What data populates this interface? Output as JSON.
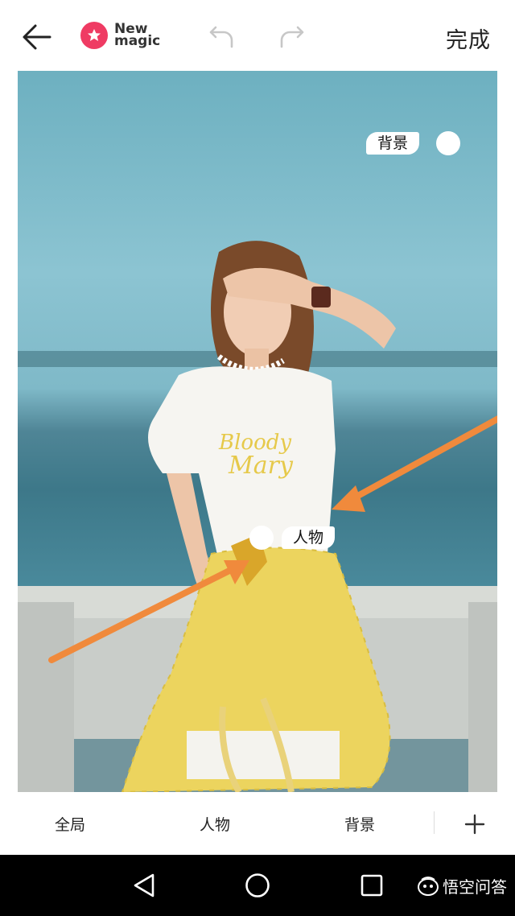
{
  "header": {
    "logo_line1": "New",
    "logo_line2": "magic",
    "done_label": "完成"
  },
  "photo": {
    "shirt_text_line1": "Bloody",
    "shirt_text_line2": "Mary",
    "tag_background": "背景",
    "tag_person": "人物"
  },
  "tabs": [
    {
      "label": "全局"
    },
    {
      "label": "人物"
    },
    {
      "label": "背景"
    }
  ],
  "watermark": {
    "text": "悟空问答"
  },
  "colors": {
    "brand": "#ef3b63",
    "arrow": "#f08a3c",
    "navbar": "#000000"
  },
  "icons": [
    "back-arrow-icon",
    "logo-star-icon",
    "undo-icon",
    "redo-icon",
    "add-icon",
    "nav-back-icon",
    "nav-home-icon",
    "nav-recent-icon"
  ]
}
